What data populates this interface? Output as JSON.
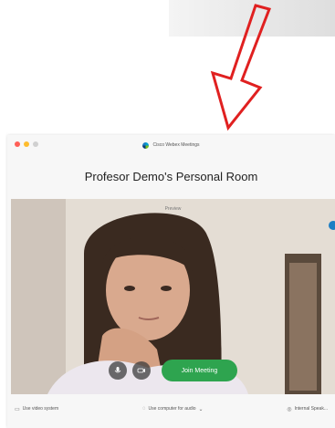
{
  "window": {
    "app_title": "Cisco Webex Meetings",
    "room_title": "Profesor Demo's Personal Room"
  },
  "video": {
    "preview_label": "Preview"
  },
  "controls": {
    "join_label": "Join Meeting"
  },
  "bottom_bar": {
    "left_label": "Use video system",
    "center_label": "Use computer for audio",
    "right_label": "Internal Speak..."
  },
  "colors": {
    "annotation_arrow": "#e02020",
    "join_button": "#2ea44f",
    "traffic_red": "#ff5f57",
    "traffic_yellow": "#febc2e",
    "traffic_green": "#d0d0d0"
  }
}
